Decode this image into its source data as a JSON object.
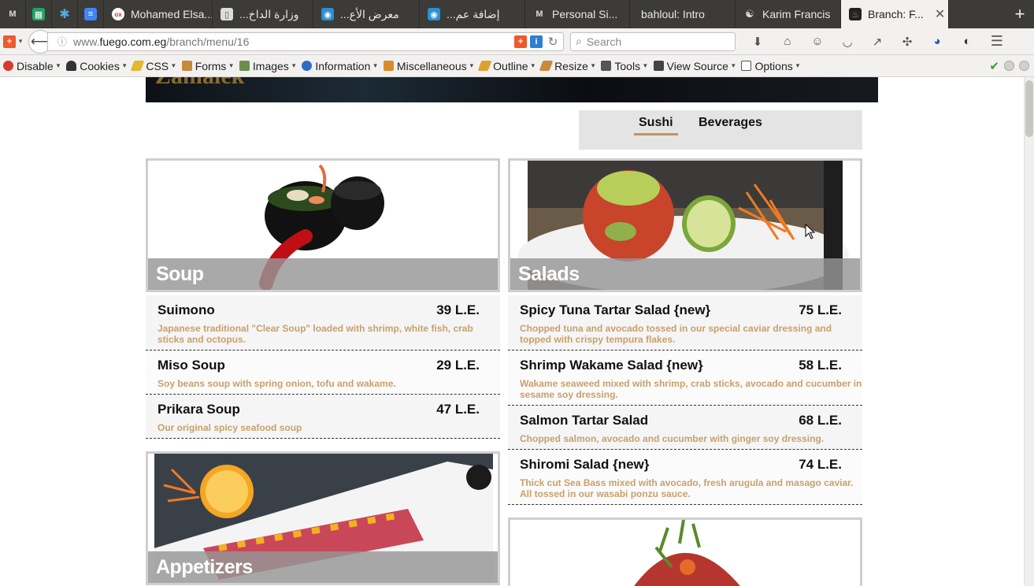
{
  "browser": {
    "tabs": [
      {
        "label": "",
        "icon": "gmail-icon",
        "pinned": true
      },
      {
        "label": "",
        "icon": "sheets-icon",
        "pinned": true
      },
      {
        "label": "",
        "icon": "asterisk-app-icon",
        "pinned": true
      },
      {
        "label": "",
        "icon": "docs-icon",
        "pinned": true
      },
      {
        "label": "Mohamed Elsa...",
        "icon": "olx-icon"
      },
      {
        "label": "...وزارة الداخ",
        "icon": "doc-icon"
      },
      {
        "label": "...معرض الأع",
        "icon": "wave-icon"
      },
      {
        "label": "...إضافة عم",
        "icon": "wave-icon"
      },
      {
        "label": "Personal Si...",
        "icon": "gmail-icon"
      },
      {
        "label": "bahloul: Intro",
        "icon": ""
      },
      {
        "label": "Karim Francis",
        "icon": "github-icon"
      },
      {
        "label": "Branch: F...",
        "icon": "fuego-icon",
        "active": true
      }
    ],
    "url_prefix": "www.",
    "url_host": "fuego.com.eg",
    "url_path": "/branch/menu/16",
    "search_placeholder": "Search"
  },
  "devtoolbar": {
    "items": [
      {
        "label": "Disable",
        "icon": "disable-icon",
        "color": "#d9382c"
      },
      {
        "label": "Cookies",
        "icon": "user-icon",
        "color": "#333333"
      },
      {
        "label": "CSS",
        "icon": "pencil-icon",
        "color": "#e4b72f"
      },
      {
        "label": "Forms",
        "icon": "clipboard-icon",
        "color": "#c58a3a"
      },
      {
        "label": "Images",
        "icon": "image-icon",
        "color": "#6b8e4e"
      },
      {
        "label": "Information",
        "icon": "info-icon",
        "color": "#2d6dc1"
      },
      {
        "label": "Miscellaneous",
        "icon": "box-icon",
        "color": "#d98c2c"
      },
      {
        "label": "Outline",
        "icon": "pencil-icon",
        "color": "#e0a030"
      },
      {
        "label": "Resize",
        "icon": "ruler-icon",
        "color": "#c98a3b"
      },
      {
        "label": "Tools",
        "icon": "tools-icon",
        "color": "#555555"
      },
      {
        "label": "View Source",
        "icon": "monitor-icon",
        "color": "#444444"
      },
      {
        "label": "Options",
        "icon": "options-icon",
        "color": "#555555"
      }
    ]
  },
  "page": {
    "banner_text": "Zamalek",
    "categories": [
      "Sushi",
      "Beverages"
    ],
    "active_category": "Sushi",
    "sections": {
      "soup": {
        "title": "Soup",
        "items": [
          {
            "name": "Suimono",
            "price": "39 L.E.",
            "desc": "Japanese traditional \"Clear Soup\" loaded with shrimp, white fish, crab sticks and octopus."
          },
          {
            "name": "Miso Soup",
            "price": "29 L.E.",
            "desc": "Soy beans soup with spring onion, tofu and wakame."
          },
          {
            "name": "Prikara Soup",
            "price": "47 L.E.",
            "desc": "Our original spicy seafood soup"
          }
        ]
      },
      "salads": {
        "title": "Salads",
        "items": [
          {
            "name": "Spicy Tuna Tartar Salad {new}",
            "price": "75 L.E.",
            "desc": "Chopped tuna and avocado tossed in our special caviar dressing and topped with crispy tempura flakes."
          },
          {
            "name": "Shrimp Wakame Salad {new}",
            "price": "58 L.E.",
            "desc": "Wakame seaweed mixed with shrimp, crab sticks, avocado and cucumber in sesame soy dressing."
          },
          {
            "name": "Salmon Tartar Salad",
            "price": "68 L.E.",
            "desc": "Chopped salmon, avocado and cucumber with ginger soy dressing."
          },
          {
            "name": "Shiromi Salad {new}",
            "price": "74 L.E.",
            "desc": "Thick cut Sea Bass mixed with avocado, fresh arugula and masago caviar. All tossed in our wasabi ponzu sauce."
          }
        ]
      },
      "appetizers": {
        "title": "Appetizers"
      }
    }
  }
}
